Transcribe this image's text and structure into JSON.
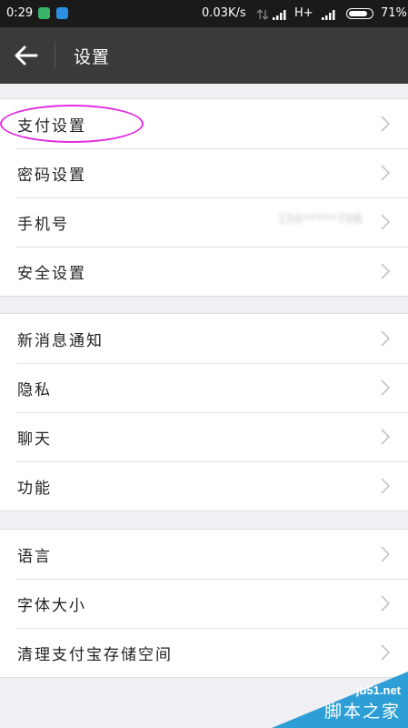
{
  "status_bar": {
    "time": "0:29",
    "network_speed": "0.03K/s",
    "network_type": "H+",
    "battery_percent": "71%",
    "battery_level": 0.71
  },
  "nav": {
    "back_icon": "arrow-left-icon",
    "title": "设置"
  },
  "groups": [
    {
      "items": [
        {
          "label": "支付设置"
        },
        {
          "label": "密码设置"
        },
        {
          "label": "手机号",
          "value": "150*****708"
        },
        {
          "label": "安全设置"
        }
      ]
    },
    {
      "items": [
        {
          "label": "新消息通知"
        },
        {
          "label": "隐私"
        },
        {
          "label": "聊天"
        },
        {
          "label": "功能"
        }
      ]
    },
    {
      "items": [
        {
          "label": "语言"
        },
        {
          "label": "字体大小"
        },
        {
          "label": "清理支付宝存储空间"
        }
      ]
    }
  ],
  "annotation": {
    "color": "#e22ce0"
  },
  "watermark": {
    "site": "jb51.net",
    "cn": "脚本之家",
    "color": "#2d9fd6"
  }
}
